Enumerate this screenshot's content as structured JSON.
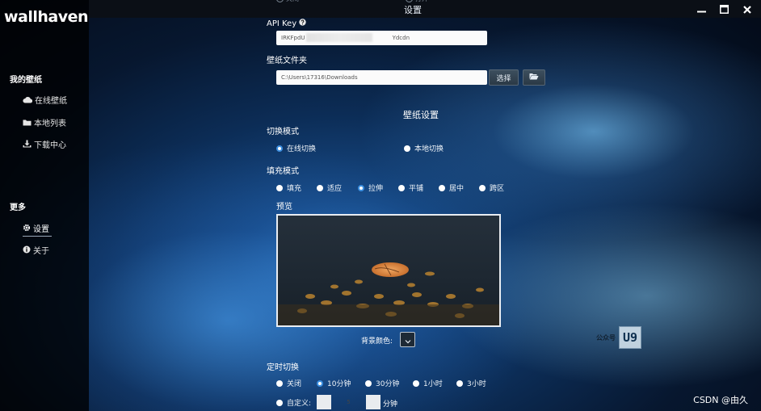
{
  "app": {
    "logo": "wallhaven",
    "window_title": "设置",
    "ghost_above": [
      "关闭",
      "打开"
    ]
  },
  "sidebar": {
    "section_mine": "我的壁纸",
    "items_mine": [
      {
        "label": "在线壁纸",
        "icon": "cloud-icon"
      },
      {
        "label": "本地列表",
        "icon": "folder-icon"
      },
      {
        "label": "下载中心",
        "icon": "download-icon"
      }
    ],
    "section_more": "更多",
    "items_more": [
      {
        "label": "设置",
        "icon": "gear-icon",
        "active": true
      },
      {
        "label": "关于",
        "icon": "info-icon"
      }
    ]
  },
  "settings": {
    "api_key_label": "API Key",
    "api_key_value_start": "IRKFpdU",
    "api_key_value_end": "Ydcdn",
    "folder_label": "壁纸文件夹",
    "folder_value": "C:\\Users\\17316\\Downloads",
    "choose_button": "选择",
    "wallpaper_heading": "壁纸设置",
    "switch_mode_label": "切换模式",
    "switch_modes": [
      {
        "label": "在线切换",
        "checked": true
      },
      {
        "label": "本地切换",
        "checked": false
      }
    ],
    "fill_mode_label": "填充模式",
    "fill_modes": [
      {
        "label": "填充",
        "checked": false
      },
      {
        "label": "适应",
        "checked": false
      },
      {
        "label": "拉伸",
        "checked": true
      },
      {
        "label": "平铺",
        "checked": false
      },
      {
        "label": "居中",
        "checked": false
      },
      {
        "label": "跨区",
        "checked": false
      }
    ],
    "preview_label": "预览",
    "bg_color_label": "背景颜色:",
    "timer_label": "定时切换",
    "timer_options": [
      {
        "label": "关闭",
        "checked": false
      },
      {
        "label": "10分钟",
        "checked": true
      },
      {
        "label": "30分钟",
        "checked": false
      },
      {
        "label": "1小时",
        "checked": false
      },
      {
        "label": "3小时",
        "checked": false
      }
    ],
    "custom_label": "自定义:",
    "custom_value": "5",
    "custom_unit": "分钟"
  },
  "watermark": {
    "text": "公众号",
    "badge": "U9"
  },
  "credit": "CSDN @由久",
  "colors": {
    "accent": "#3c8fe0",
    "sidebar_bg": "#000000",
    "titlebar_bg": "#0b0f16"
  }
}
